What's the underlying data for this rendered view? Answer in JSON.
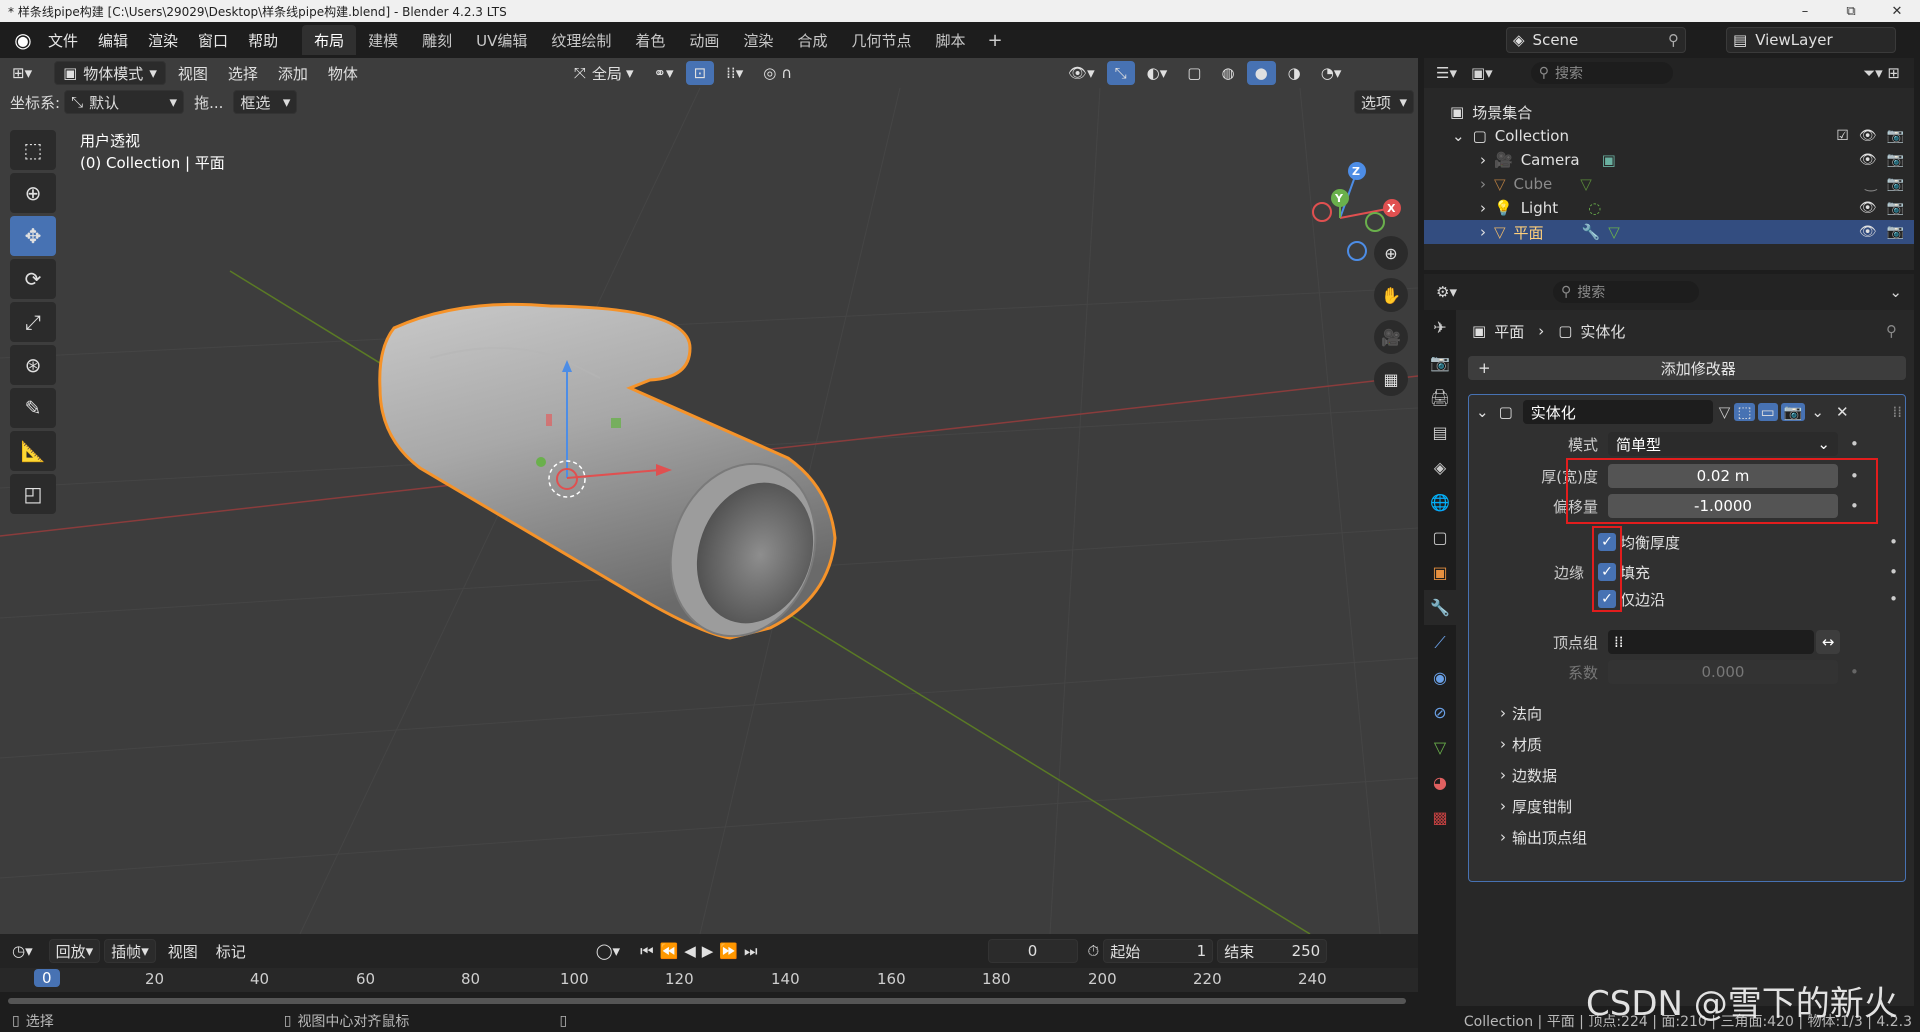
{
  "window": {
    "title": "* 样条线pipe构建 [C:\\Users\\29029\\Desktop\\样条线pipe构建.blend] - Blender 4.2.3 LTS",
    "min": "–",
    "max": "⧉",
    "close": "✕"
  },
  "menu": [
    "文件",
    "编辑",
    "渲染",
    "窗口",
    "帮助"
  ],
  "workspaces": [
    "布局",
    "建模",
    "雕刻",
    "UV编辑",
    "纹理绘制",
    "着色",
    "动画",
    "渲染",
    "合成",
    "几何节点",
    "脚本"
  ],
  "active_workspace": "布局",
  "scene": "Scene",
  "view_layer": "ViewLayer",
  "viewport": {
    "mode": "物体模式",
    "menus": [
      "视图",
      "选择",
      "添加",
      "物体"
    ],
    "transform_orientation": "全局",
    "coord_label": "坐标系:",
    "coord_value": "默认",
    "drag_label": "拖...",
    "select_mode": "框选",
    "options": "选项",
    "info_line1": "用户透视",
    "info_line2": "(0) Collection | 平面",
    "gizmo": {
      "x": "X",
      "y": "Y",
      "z": "Z"
    }
  },
  "timeline": {
    "menus": [
      "回放",
      "插帧",
      "视图",
      "标记"
    ],
    "current_frame": "0",
    "start_label": "起始",
    "start": "1",
    "end_label": "结束",
    "end": "250",
    "ticks": [
      "0",
      "20",
      "40",
      "60",
      "80",
      "100",
      "120",
      "140",
      "160",
      "180",
      "200",
      "220",
      "240"
    ]
  },
  "status": {
    "left": "选择",
    "middle": "视图中心对齐鼠标",
    "right": "Collection | 平面 | 顶点:224 | 面:210 | 三角面:420 | 物体:1/3 | 4.2.3"
  },
  "outliner": {
    "search_placeholder": "搜索",
    "root": "场景集合",
    "collection": "Collection",
    "items": [
      {
        "name": "Camera",
        "color": "#e6b46a"
      },
      {
        "name": "Cube",
        "color": "#d9904a"
      },
      {
        "name": "Light",
        "color": "#e6b46a"
      },
      {
        "name": "平面",
        "color": "#e6b46a"
      }
    ]
  },
  "properties": {
    "search_placeholder": "搜索",
    "breadcrumb_object": "平面",
    "breadcrumb_modifier": "实体化",
    "add_modifier": "添加修改器",
    "modifier_name": "实体化",
    "mode_label": "模式",
    "mode_value": "简单型",
    "thickness_label": "厚(宽)度",
    "thickness_value": "0.02 m",
    "offset_label": "偏移量",
    "offset_value": "-1.0000",
    "even_thickness": "均衡厚度",
    "rim_label": "边缘",
    "fill": "填充",
    "rim_only": "仅边沿",
    "vertex_group_label": "顶点组",
    "factor_label": "系数",
    "factor_value": "0.000",
    "subpanels": [
      "法向",
      "材质",
      "边数据",
      "厚度钳制",
      "输出顶点组"
    ]
  },
  "watermark": "CSDN @雪下的新火",
  "colors": {
    "accent": "#4772b3",
    "selection_outline": "#f5932a",
    "highlight_box": "#e21d1d"
  }
}
